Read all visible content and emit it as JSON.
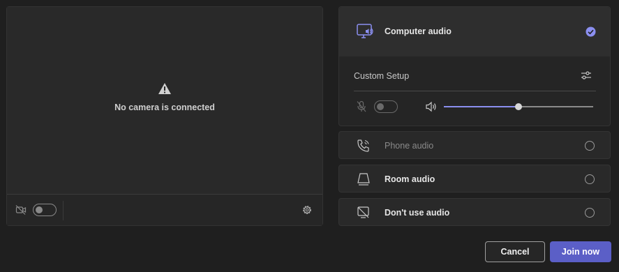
{
  "camera": {
    "message": "No camera is connected",
    "toggle_state": "off"
  },
  "audio_options": {
    "computer": {
      "label": "Computer audio",
      "selected": true
    },
    "custom_setup_label": "Custom Setup",
    "mic_toggle_state": "off",
    "speaker_volume": 0.5,
    "phone": {
      "label": "Phone audio",
      "selected": false
    },
    "room": {
      "label": "Room audio",
      "selected": false
    },
    "none": {
      "label": "Don't use audio",
      "selected": false
    }
  },
  "actions": {
    "cancel_label": "Cancel",
    "join_label": "Join now"
  },
  "colors": {
    "accent": "#5b5fc7",
    "accent_light": "#8b8ff0",
    "background": "#1f1f1f",
    "panel": "#292929"
  },
  "icons": {
    "warning": "warning-triangle-icon",
    "camera_off": "camera-off-icon",
    "settings": "gear-icon",
    "computer_audio": "monitor-speaker-icon",
    "selected_check": "check-circle-icon",
    "adjust": "sliders-icon",
    "mic_off": "mic-off-icon",
    "speaker": "speaker-icon",
    "phone": "phone-icon",
    "room": "room-device-icon",
    "no_audio": "no-audio-icon"
  }
}
